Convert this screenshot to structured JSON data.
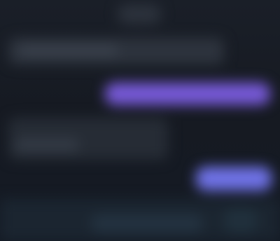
{
  "colors": {
    "background": "#161a22",
    "incoming_bubble": "#2d333d",
    "outgoing_bubble_primary": "#7659d6",
    "outgoing_bubble_secondary": "#6f72e6",
    "composer_bar": "#1b2530"
  },
  "header": {
    "title": ""
  },
  "messages": [
    {
      "direction": "incoming",
      "text": ""
    },
    {
      "direction": "outgoing",
      "text": ""
    },
    {
      "direction": "incoming",
      "text": ""
    },
    {
      "direction": "outgoing",
      "text": ""
    }
  ],
  "composer": {
    "placeholder": "",
    "send_icon": "send-icon"
  }
}
